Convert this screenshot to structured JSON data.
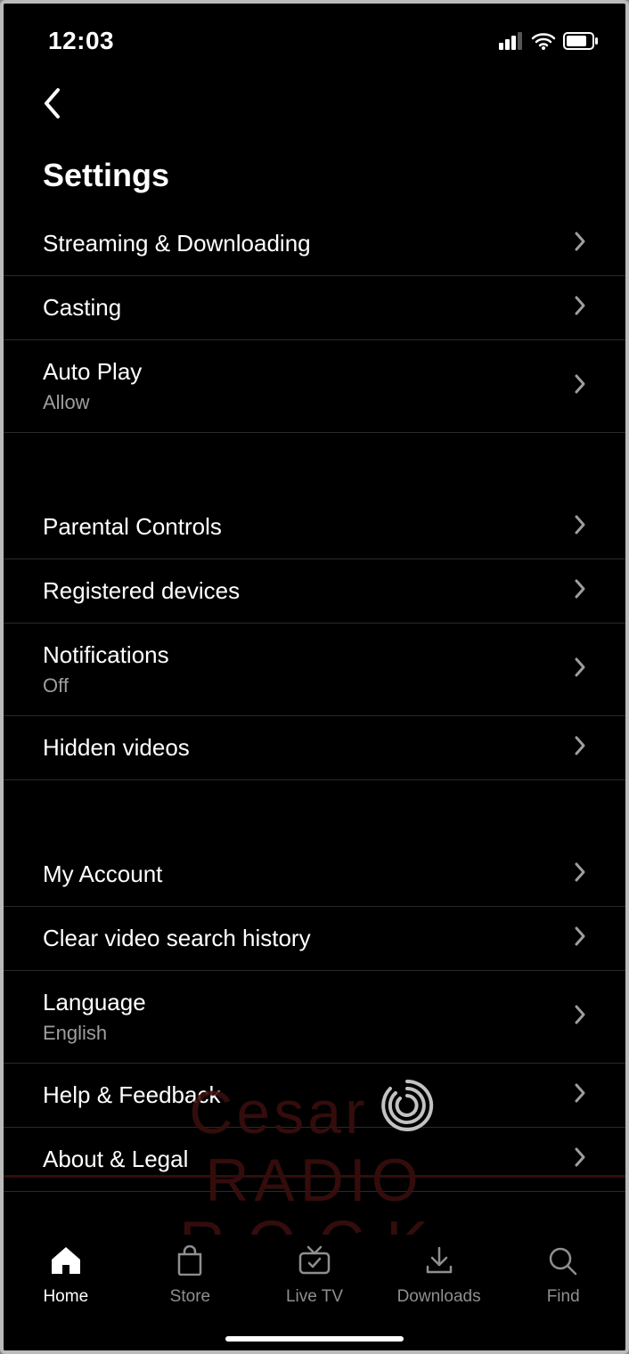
{
  "status": {
    "time": "12:03"
  },
  "header": {
    "title": "Settings"
  },
  "sections": [
    {
      "rows": [
        {
          "label": "Streaming & Downloading",
          "sublabel": null
        },
        {
          "label": "Casting",
          "sublabel": null
        },
        {
          "label": "Auto Play",
          "sublabel": "Allow"
        }
      ]
    },
    {
      "rows": [
        {
          "label": "Parental Controls",
          "sublabel": null
        },
        {
          "label": "Registered devices",
          "sublabel": null
        },
        {
          "label": "Notifications",
          "sublabel": "Off"
        },
        {
          "label": "Hidden videos",
          "sublabel": null
        }
      ]
    },
    {
      "rows": [
        {
          "label": "My Account",
          "sublabel": null
        },
        {
          "label": "Clear video search history",
          "sublabel": null
        },
        {
          "label": "Language",
          "sublabel": "English"
        },
        {
          "label": "Help & Feedback",
          "sublabel": null
        },
        {
          "label": "About & Legal",
          "sublabel": null
        }
      ]
    }
  ],
  "nav": {
    "items": [
      {
        "label": "Home",
        "active": true
      },
      {
        "label": "Store",
        "active": false
      },
      {
        "label": "Live TV",
        "active": false
      },
      {
        "label": "Downloads",
        "active": false
      },
      {
        "label": "Find",
        "active": false
      }
    ]
  },
  "watermark": {
    "line1": "Cesar",
    "line2": "RADIO",
    "line3": "ROCK"
  }
}
